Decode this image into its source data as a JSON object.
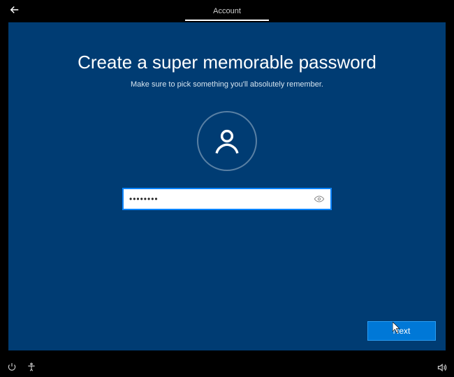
{
  "header": {
    "tab_label": "Account"
  },
  "main": {
    "title": "Create a super memorable password",
    "subtitle": "Make sure to pick something you'll absolutely remember.",
    "password_value": "••••••••"
  },
  "actions": {
    "next_label": "Next"
  },
  "icons": {
    "back": "back-arrow-icon",
    "avatar": "user-avatar-icon",
    "reveal": "password-reveal-icon",
    "power": "power-icon",
    "ease": "ease-of-access-icon",
    "volume": "volume-icon"
  }
}
